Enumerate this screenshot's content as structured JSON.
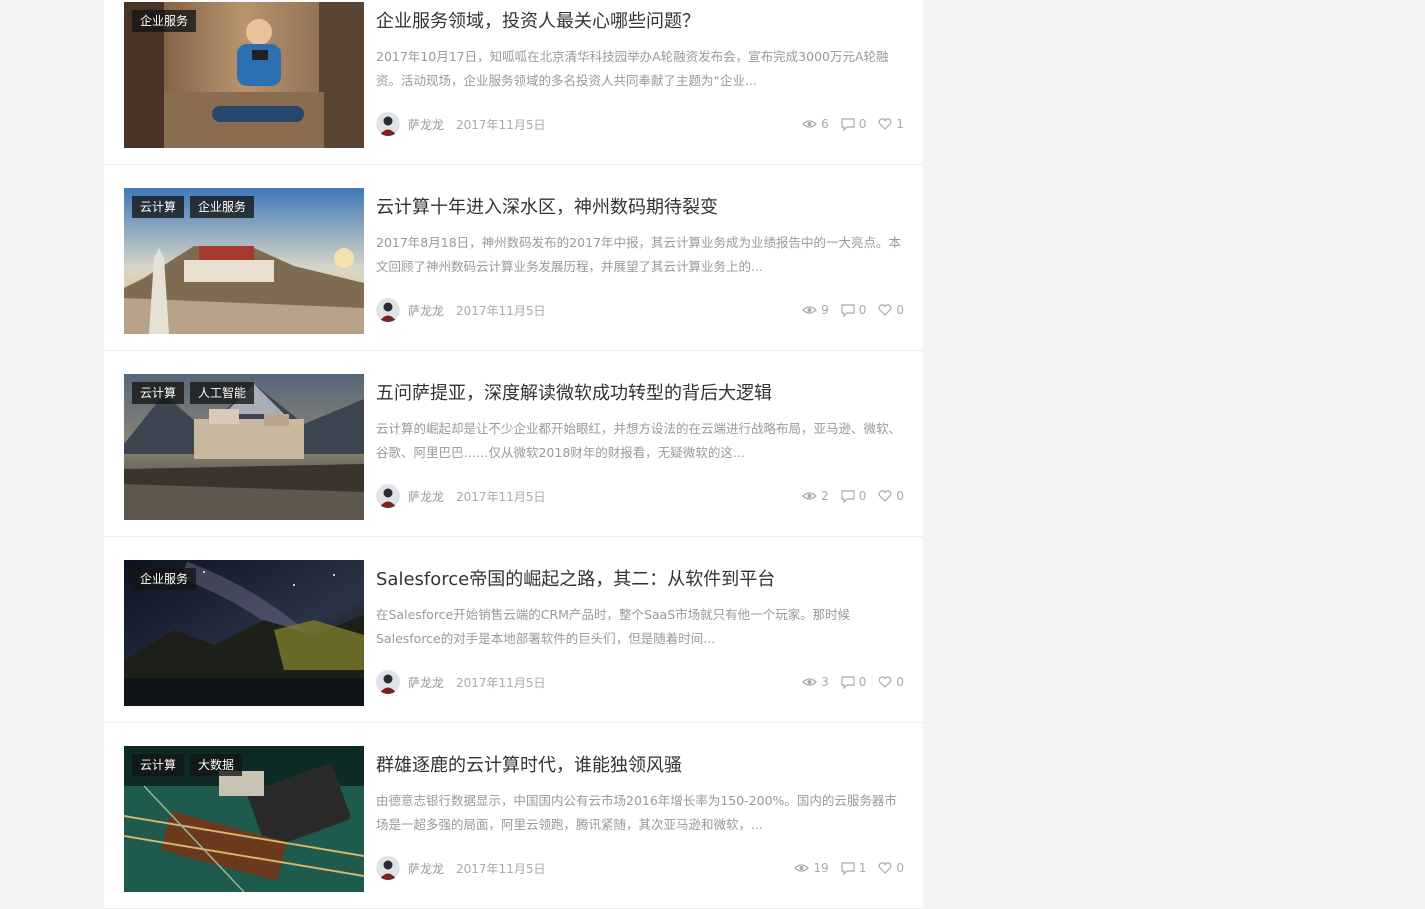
{
  "posts": [
    {
      "tags": [
        "企业服务"
      ],
      "title": "企业服务领域，投资人最关心哪些问题？",
      "excerpt": "2017年10月17日，知呱呱在北京清华科技园举办A轮融资发布会，宣布完成3000万元A轮融资。活动现场，企业服务领域的多名投资人共同奉献了主题为“企业...",
      "author": "萨龙龙",
      "date": "2017年11月5日",
      "views": "6",
      "comments": "0",
      "likes": "1"
    },
    {
      "tags": [
        "云计算",
        "企业服务"
      ],
      "title": "云计算十年进入深水区，神州数码期待裂变",
      "excerpt": "2017年8月18日，神州数码发布的2017年中报，其云计算业务成为业绩报告中的一大亮点。本文回顾了神州数码云计算业务发展历程，并展望了其云计算业务上的...",
      "author": "萨龙龙",
      "date": "2017年11月5日",
      "views": "9",
      "comments": "0",
      "likes": "0"
    },
    {
      "tags": [
        "云计算",
        "人工智能"
      ],
      "title": "五问萨提亚，深度解读微软成功转型的背后大逻辑",
      "excerpt": "云计算的崛起却是让不少企业都开始眼红，并想方设法的在云端进行战略布局，亚马逊、微软、谷歌、阿里巴巴……仅从微软2018财年的财报看，无疑微软的这...",
      "author": "萨龙龙",
      "date": "2017年11月5日",
      "views": "2",
      "comments": "0",
      "likes": "0"
    },
    {
      "tags": [
        "企业服务"
      ],
      "title": "Salesforce帝国的崛起之路，其二：从软件到平台",
      "excerpt": "在Salesforce开始销售云端的CRM产品时，整个SaaS市场就只有他一个玩家。那时候Salesforce的对手是本地部署软件的巨头们，但是随着时间...",
      "author": "萨龙龙",
      "date": "2017年11月5日",
      "views": "3",
      "comments": "0",
      "likes": "0"
    },
    {
      "tags": [
        "云计算",
        "大数据"
      ],
      "title": "群雄逐鹿的云计算时代，谁能独领风骚",
      "excerpt": "由德意志银行数据显示，中国国内公有云市场2016年增长率为150-200%。国内的云服务器市场是一超多强的局面，阿里云领跑，腾讯紧随，其次亚马逊和微软，...",
      "author": "萨龙龙",
      "date": "2017年11月5日",
      "views": "19",
      "comments": "1",
      "likes": "0"
    }
  ],
  "icons": {
    "views": "eye-icon",
    "comments": "comment-icon",
    "likes": "heart-icon"
  }
}
